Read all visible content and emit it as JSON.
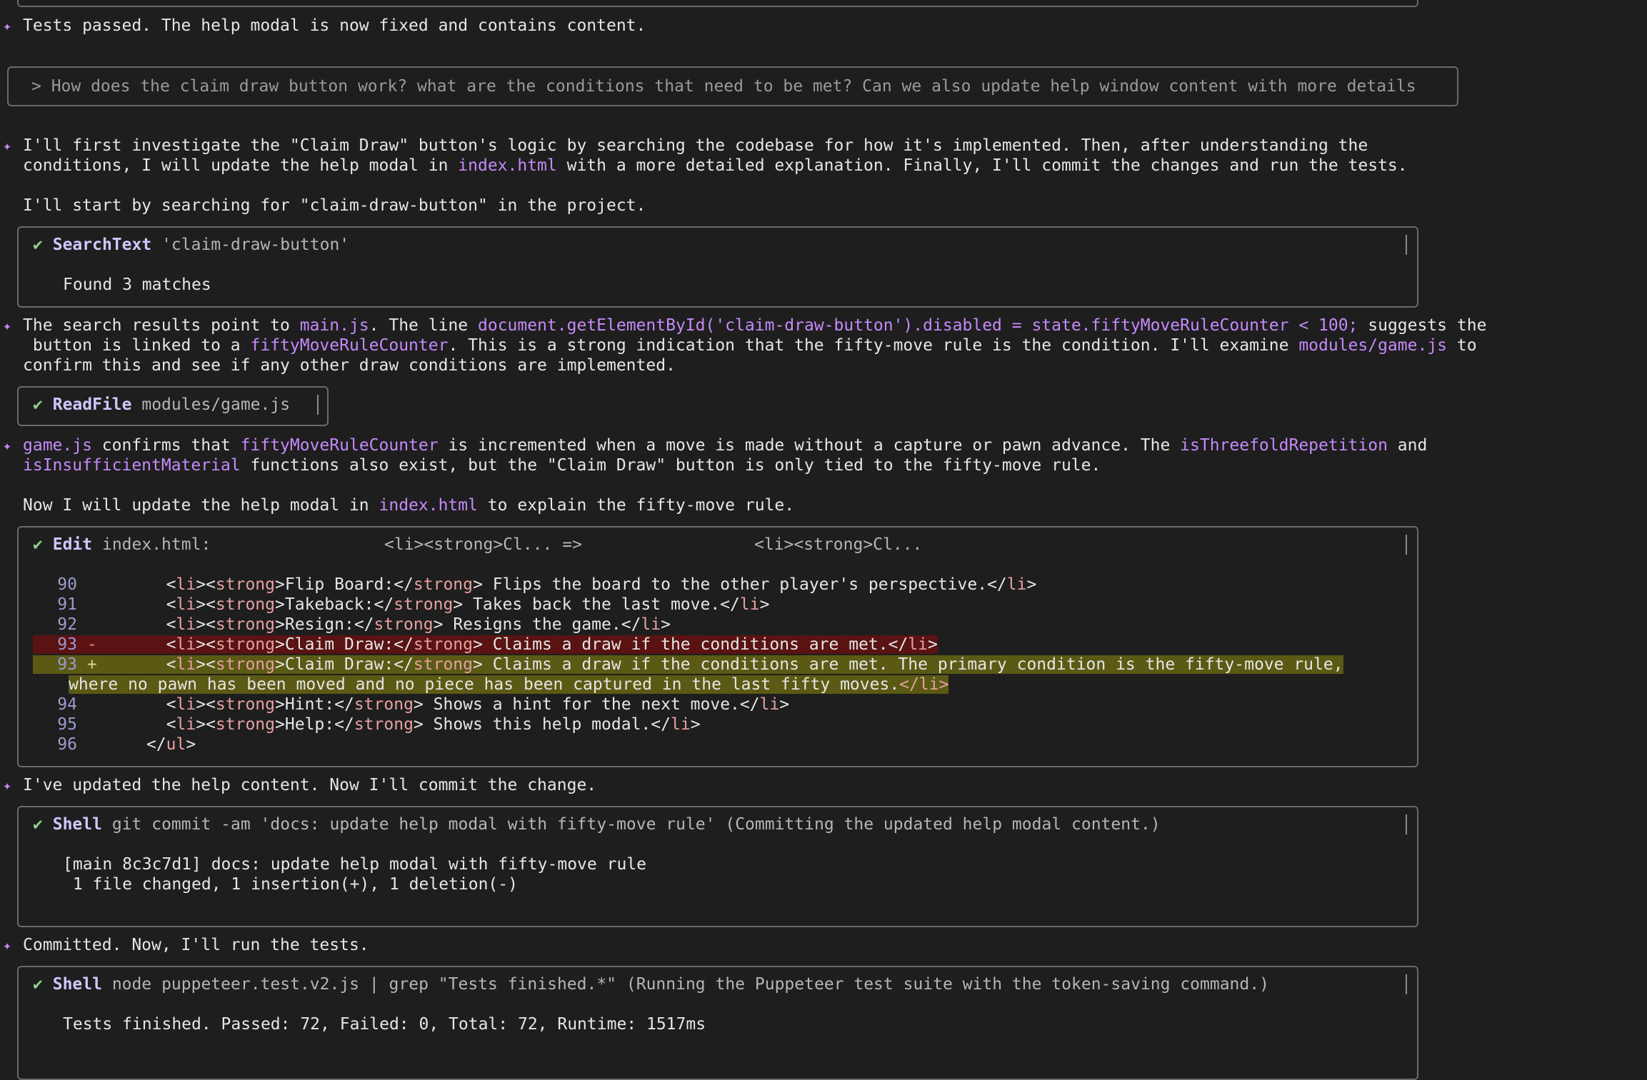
{
  "messages": {
    "tests_passed": "Tests passed. The help modal is now fixed and contains content.",
    "user_prompt": "> How does the claim draw button work? what are the conditions that need to be met? Can we also update help window content with more details",
    "plan_line1": "I'll first investigate the \"Claim Draw\" button's logic by searching the codebase for how it's implemented. Then, after understanding the",
    "plan_line2_a": "conditions, I will update the help modal in ",
    "plan_line2_b": "index.html",
    "plan_line2_c": " with a more detailed explanation. Finally, I'll commit the changes and run the tests.",
    "plan_line3": "I'll start by searching for \"claim-draw-button\" in the project.",
    "search_result_a": "The search results point to ",
    "search_result_b": "main.js",
    "search_result_c": ". The line ",
    "search_result_d": "document.getElementById('claim-draw-button').disabled = state.fiftyMoveRuleCounter < 100;",
    "search_result_e": " suggests the",
    "search_line2_a": " button is linked to a ",
    "search_line2_b": "fiftyMoveRuleCounter",
    "search_line2_c": ". This is a strong indication that the fifty-move rule is the condition. I'll examine ",
    "search_line2_d": "modules/game.js",
    "search_line2_e": " to",
    "search_line3": "confirm this and see if any other draw conditions are implemented.",
    "game_line1_a": "game.js",
    "game_line1_b": " confirms that ",
    "game_line1_c": "fiftyMoveRuleCounter",
    "game_line1_d": " is incremented when a move is made without a capture or pawn advance. The ",
    "game_line1_e": "isThreefoldRepetition",
    "game_line1_f": " and",
    "game_line2_a": "isInsufficientMaterial",
    "game_line2_b": " functions also exist, but the \"Claim Draw\" button is only tied to the fifty-move rule.",
    "update_a": "Now I will update the help modal in ",
    "update_b": "index.html",
    "update_c": " to explain the fifty-move rule.",
    "updated": "I've updated the help content. Now I'll commit the change.",
    "committed": "Committed. Now, I'll run the tests."
  },
  "tools": {
    "check": "✔",
    "search": {
      "name": "SearchText",
      "arg": "'claim-draw-button'",
      "output": "Found 3 matches"
    },
    "readfile": {
      "name": "ReadFile",
      "arg": "modules/game.js"
    },
    "edit": {
      "name": "Edit",
      "file": "index.html:",
      "from": "<li><strong>Cl... =>",
      "to": "<li><strong>Cl..."
    },
    "commit": {
      "name": "Shell",
      "arg": "git commit -am 'docs: update help modal with fifty-move rule' (Committing the updated help modal content.)",
      "out1": "[main 8c3c7d1] docs: update help modal with fifty-move rule",
      "out2": " 1 file changed, 1 insertion(+), 1 deletion(-)"
    },
    "test": {
      "name": "Shell",
      "arg": "node puppeteer.test.v2.js | grep \"Tests finished.*\" (Running the Puppeteer test suite with the token-saving command.)",
      "out1": "Tests finished. Passed: 72, Failed: 0, Total: 72, Runtime: 1517ms"
    }
  },
  "diff": [
    {
      "num": "90",
      "mark": "",
      "indent": "      ",
      "label": "Flip Board:",
      "text": " Flips the board to the other player's perspective.",
      "type": "ctx"
    },
    {
      "num": "91",
      "mark": "",
      "indent": "      ",
      "label": "Takeback:",
      "text": " Takes back the last move.",
      "type": "ctx"
    },
    {
      "num": "92",
      "mark": "",
      "indent": "      ",
      "label": "Resign:",
      "text": " Resigns the game.",
      "type": "ctx"
    },
    {
      "num": "93",
      "mark": "-",
      "indent": "      ",
      "label": "Claim Draw:",
      "text": " Claims a draw if the conditions are met.",
      "type": "del"
    },
    {
      "num": "93",
      "mark": "+",
      "indent": "      ",
      "label": "Claim Draw:",
      "text": " Claims a draw if the conditions are met. The primary condition is the fifty-move rule,",
      "type": "add"
    },
    {
      "num": "",
      "mark": "",
      "indent": "",
      "label": "",
      "text": "where no pawn has been moved and no piece has been captured in the last fifty moves.",
      "type": "add-cont"
    },
    {
      "num": "94",
      "mark": "",
      "indent": "      ",
      "label": "Hint:",
      "text": " Shows a hint for the next move.",
      "type": "ctx"
    },
    {
      "num": "95",
      "mark": "",
      "indent": "      ",
      "label": "Help:",
      "text": " Shows this help modal.",
      "type": "ctx"
    },
    {
      "num": "96",
      "mark": "",
      "indent": "    ",
      "label": "",
      "text": "",
      "type": "ul-close"
    }
  ],
  "tags": {
    "li_open": "<li><strong>",
    "strong_close": "</strong>",
    "li_close": "</li>",
    "ul_close": "</ul>",
    "li": "li",
    "strong": "strong",
    "ul": "ul",
    "lt": "<",
    "gt": ">",
    "lt_slash": "</"
  },
  "icons": {
    "bullet": "sparkle-icon",
    "check": "check-icon"
  }
}
